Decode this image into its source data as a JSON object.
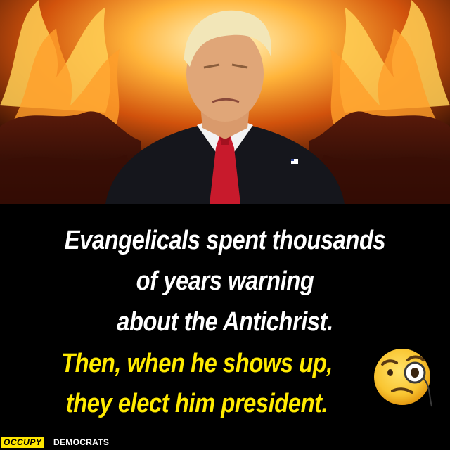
{
  "caption": {
    "white_lines": [
      "Evangelicals spent thousands",
      "of years warning",
      "about the Antichrist."
    ],
    "yellow_lines": [
      "Then, when he shows up,",
      "they elect him president."
    ]
  },
  "emoji": {
    "icon": "face-with-monocle-icon"
  },
  "branding": {
    "badge": "OCCUPY",
    "name": "DEMOCRATS",
    "badge_color": "#ffe600"
  },
  "colors": {
    "white_text": "#ffffff",
    "yellow_text": "#ffea00",
    "background": "#000000"
  }
}
